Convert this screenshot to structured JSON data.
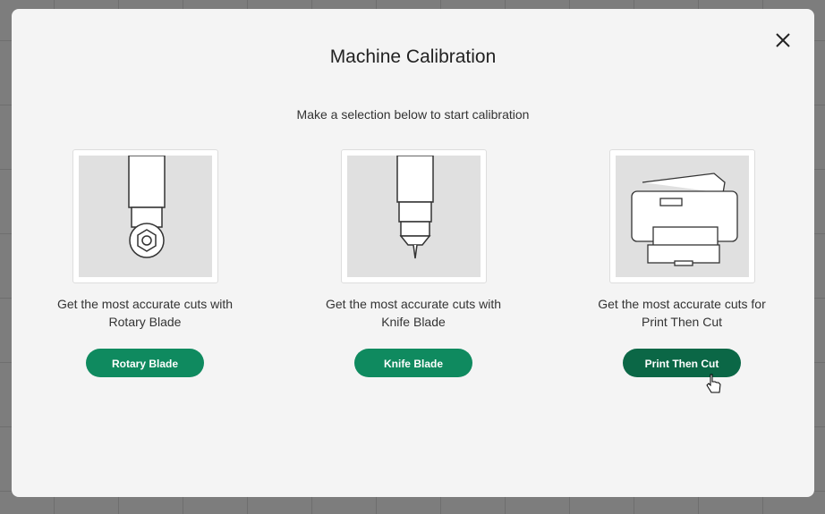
{
  "modal": {
    "title": "Machine Calibration",
    "subtitle": "Make a selection below to start calibration",
    "options": [
      {
        "desc1": "Get the most accurate cuts with",
        "desc2": "Rotary Blade",
        "button": "Rotary Blade",
        "icon": "rotary-blade-icon"
      },
      {
        "desc1": "Get the most accurate cuts with",
        "desc2": "Knife Blade",
        "button": "Knife Blade",
        "icon": "knife-blade-icon"
      },
      {
        "desc1": "Get the most accurate cuts for",
        "desc2": "Print Then Cut",
        "button": "Print Then Cut",
        "icon": "printer-icon"
      }
    ]
  },
  "colors": {
    "accent": "#0f8a5f",
    "accent_hover": "#0b6746"
  }
}
